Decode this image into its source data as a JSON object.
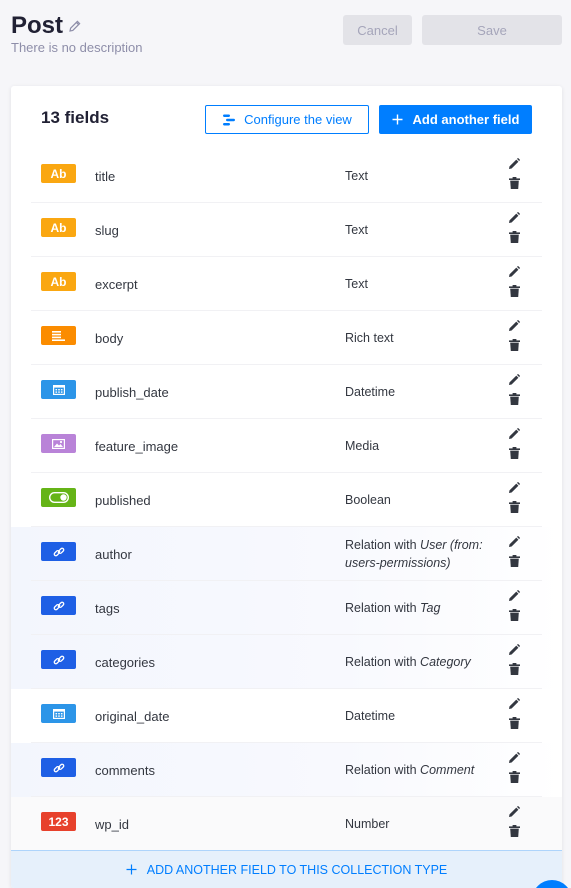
{
  "header": {
    "title": "Post",
    "description": "There is no description",
    "cancel_label": "Cancel",
    "save_label": "Save"
  },
  "card": {
    "field_count": "13 fields",
    "configure_label": "Configure the view",
    "add_field_label": "Add another field",
    "add_footer_label": "ADD ANOTHER FIELD TO THIS COLLECTION TYPE"
  },
  "fields": [
    {
      "name": "title",
      "type": "Text",
      "badge": "Ab",
      "icon": "text-icon",
      "color": "#faa711"
    },
    {
      "name": "slug",
      "type": "Text",
      "badge": "Ab",
      "icon": "text-icon",
      "color": "#faa711"
    },
    {
      "name": "excerpt",
      "type": "Text",
      "badge": "Ab",
      "icon": "text-icon",
      "color": "#faa711"
    },
    {
      "name": "body",
      "type": "Rich text",
      "badge": "",
      "icon": "richtext-icon",
      "color": "#fb8c00"
    },
    {
      "name": "publish_date",
      "type": "Datetime",
      "badge": "",
      "icon": "calendar-icon",
      "color": "#2c95e8"
    },
    {
      "name": "feature_image",
      "type": "Media",
      "badge": "",
      "icon": "media-icon",
      "color": "#b983d8"
    },
    {
      "name": "published",
      "type": "Boolean",
      "badge": "",
      "icon": "toggle-icon",
      "color": "#65b417"
    },
    {
      "name": "author",
      "type_prefix": "Relation with ",
      "type_target": "User (from: users-permissions)",
      "badge": "",
      "icon": "link-icon",
      "color": "#1e5fe5"
    },
    {
      "name": "tags",
      "type_prefix": "Relation with ",
      "type_target": "Tag",
      "badge": "",
      "icon": "link-icon",
      "color": "#1e5fe5"
    },
    {
      "name": "categories",
      "type_prefix": "Relation with ",
      "type_target": "Category",
      "badge": "",
      "icon": "link-icon",
      "color": "#1e5fe5"
    },
    {
      "name": "original_date",
      "type": "Datetime",
      "badge": "",
      "icon": "calendar-icon",
      "color": "#2c95e8"
    },
    {
      "name": "comments",
      "type_prefix": "Relation with ",
      "type_target": "Comment",
      "badge": "",
      "icon": "link-icon",
      "color": "#1e5fe5"
    },
    {
      "name": "wp_id",
      "type": "Number",
      "badge": "123",
      "icon": "number-icon",
      "color": "#e7412c"
    }
  ],
  "colors": {
    "primary": "#007eff",
    "disabled_bg": "#e3e3e8",
    "disabled_text": "#a5a5ba"
  }
}
